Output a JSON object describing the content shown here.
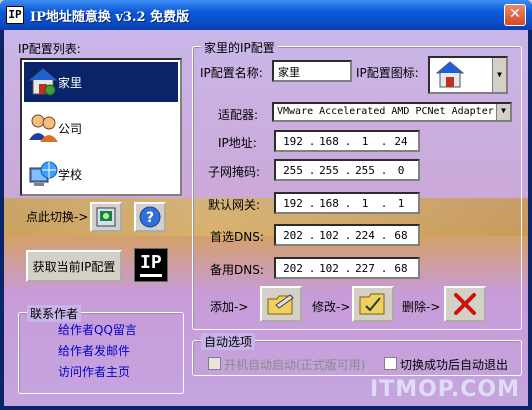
{
  "window": {
    "title": "IP地址随意换 v3.2 免费版",
    "app_icon_text": "IP",
    "close_symbol": "✕"
  },
  "ip_list": {
    "label": "IP配置列表:",
    "items": [
      {
        "label": "家里",
        "icon": "house-icon",
        "selected": true
      },
      {
        "label": "公司",
        "icon": "people-icon",
        "selected": false
      },
      {
        "label": "学校",
        "icon": "network-globe-icon",
        "selected": false
      }
    ]
  },
  "left_actions": {
    "switch_label": "点此切换->",
    "get_current_button": "获取当前IP配置",
    "ip_logo_text": "IP"
  },
  "contact": {
    "label": "联系作者",
    "links": [
      "给作者QQ留言",
      "给作者发邮件",
      "访问作者主页"
    ]
  },
  "config": {
    "group_title": "家里的IP配置",
    "name_label": "IP配置名称:",
    "name_value": "家里",
    "icon_label": "IP配置图标:",
    "adapter_label": "适配器:",
    "adapter_value": "VMware Accelerated AMD PCNet Adapter",
    "ip_label": "IP地址:",
    "ip_value": [
      "192",
      "168",
      "1",
      "24"
    ],
    "mask_label": "子网掩码:",
    "mask_value": [
      "255",
      "255",
      "255",
      "0"
    ],
    "gateway_label": "默认网关:",
    "gateway_value": [
      "192",
      "168",
      "1",
      "1"
    ],
    "dns1_label": "首选DNS:",
    "dns1_value": [
      "202",
      "102",
      "224",
      "68"
    ],
    "dns2_label": "备用DNS:",
    "dns2_value": [
      "202",
      "102",
      "227",
      "68"
    ],
    "add_label": "添加->",
    "edit_label": "修改->",
    "delete_label": "删除->"
  },
  "auto": {
    "group_title": "自动选项",
    "autostart_label": "开机自动启动(正式版可用)",
    "autoexit_label": "切换成功后自动退出"
  },
  "watermark": "ITMOP.COM"
}
